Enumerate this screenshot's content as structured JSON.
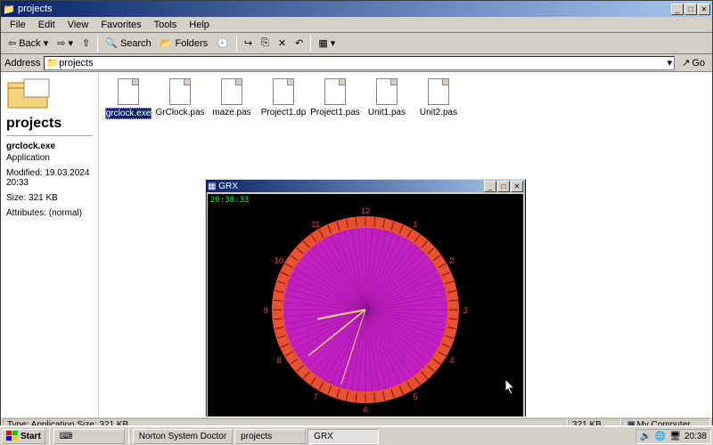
{
  "explorer": {
    "title": "projects",
    "menus": [
      "File",
      "Edit",
      "View",
      "Favorites",
      "Tools",
      "Help"
    ],
    "toolbar": {
      "back": "Back",
      "search": "Search",
      "folders": "Folders"
    },
    "address": {
      "label": "Address",
      "value": "projects",
      "go": "Go"
    },
    "leftpane": {
      "folder_name": "projects",
      "sel_name": "grclock.exe",
      "sel_type": "Application",
      "modified": "Modified: 19.03.2024 20:33",
      "size": "Size: 321 KB",
      "attributes": "Attributes: (normal)"
    },
    "files": [
      {
        "name": "grclock.exe",
        "selected": true
      },
      {
        "name": "GrClock.pas",
        "selected": false
      },
      {
        "name": "maze.pas",
        "selected": false
      },
      {
        "name": "Project1.dp",
        "selected": false
      },
      {
        "name": "Project1.pas",
        "selected": false
      },
      {
        "name": "Unit1.pas",
        "selected": false
      },
      {
        "name": "Unit2.pas",
        "selected": false
      }
    ],
    "status": {
      "left": "Type: Application Size: 321 KB",
      "right_size": "321 KB",
      "right_loc": "My Computer"
    }
  },
  "grx": {
    "title": "GRX",
    "time": "20:38:33",
    "hour_numbers": [
      "12",
      "1",
      "2",
      "3",
      "4",
      "5",
      "6",
      "7",
      "8",
      "9",
      "10",
      "11"
    ],
    "colors": {
      "face": "#c020c0",
      "rim": "#e85030",
      "hands": "#f0d080"
    }
  },
  "taskbar": {
    "start": "Start",
    "tasks": [
      {
        "label": "Norton System Doctor",
        "active": false
      },
      {
        "label": "projects",
        "active": false
      },
      {
        "label": "GRX",
        "active": true
      }
    ],
    "clock": "20:38"
  }
}
